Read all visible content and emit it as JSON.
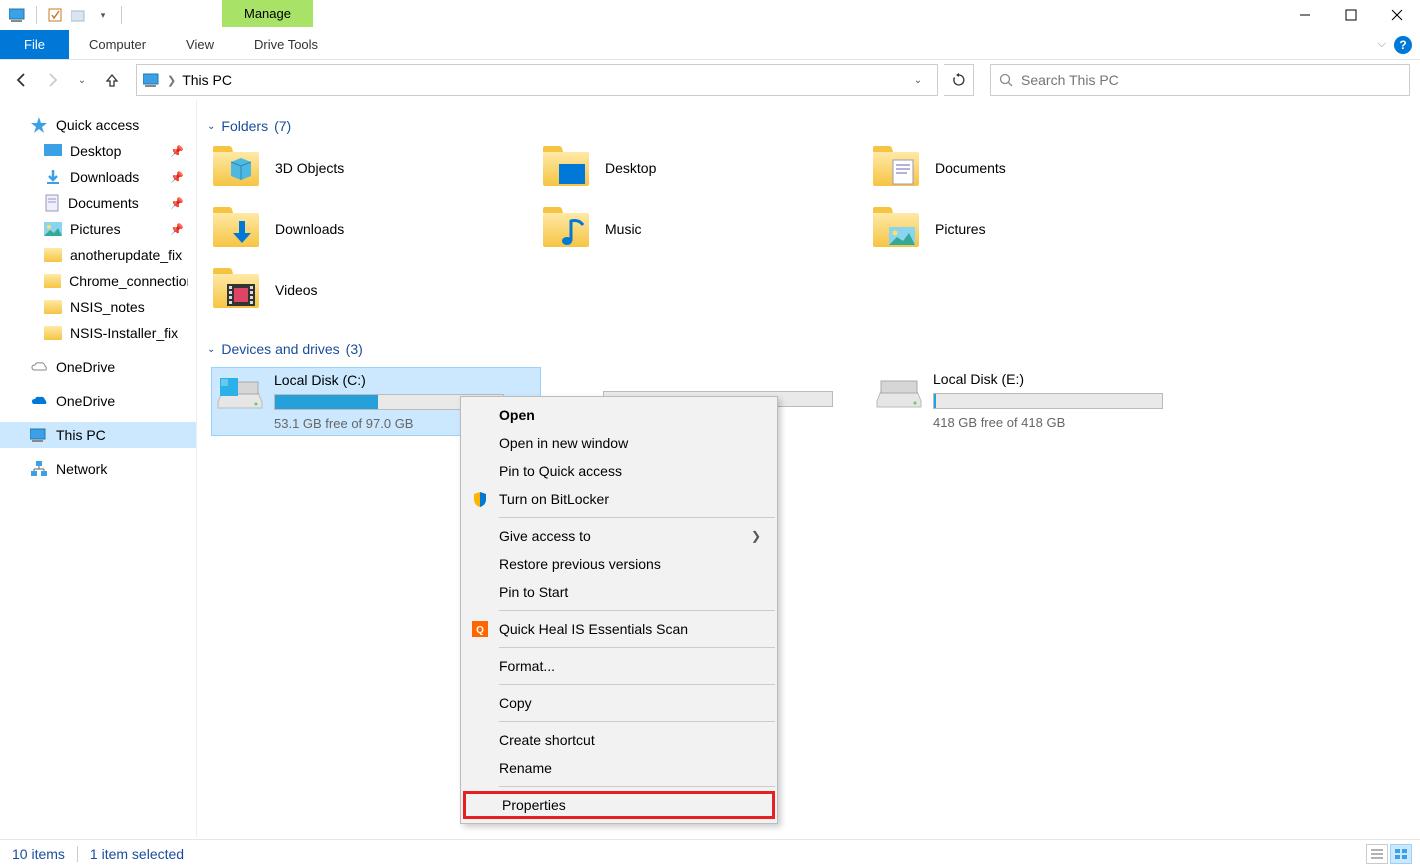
{
  "window": {
    "title": "This PC",
    "manage_label": "Manage"
  },
  "ribbon": {
    "file": "File",
    "tabs": [
      "Computer",
      "View",
      "Drive Tools"
    ]
  },
  "address": {
    "path": "This PC"
  },
  "search": {
    "placeholder": "Search This PC"
  },
  "sidebar": {
    "quick_access": "Quick access",
    "items": [
      {
        "label": "Desktop",
        "pinned": true
      },
      {
        "label": "Downloads",
        "pinned": true
      },
      {
        "label": "Documents",
        "pinned": true
      },
      {
        "label": "Pictures",
        "pinned": true
      },
      {
        "label": "anotherupdate_fix",
        "pinned": false
      },
      {
        "label": "Chrome_connection",
        "pinned": false
      },
      {
        "label": "NSIS_notes",
        "pinned": false
      },
      {
        "label": "NSIS-Installer_fix",
        "pinned": false
      }
    ],
    "onedrive1": "OneDrive",
    "onedrive2": "OneDrive",
    "this_pc": "This PC",
    "network": "Network"
  },
  "groups": {
    "folders": {
      "label": "Folders",
      "count": "(7)"
    },
    "drives": {
      "label": "Devices and drives",
      "count": "(3)"
    }
  },
  "folders": [
    "3D Objects",
    "Desktop",
    "Documents",
    "Downloads",
    "Music",
    "Pictures",
    "Videos"
  ],
  "drives": [
    {
      "name": "Local Disk (C:)",
      "free": "53.1 GB free of 97.0 GB",
      "fill_pct": 45,
      "selected": true
    },
    {
      "name": "",
      "free": "",
      "fill_pct": 0,
      "hidden_by_menu": true
    },
    {
      "name": "Local Disk (E:)",
      "free": "418 GB free of 418 GB",
      "fill_pct": 1,
      "selected": false
    }
  ],
  "context_menu": [
    {
      "label": "Open",
      "bold": true
    },
    {
      "label": "Open in new window"
    },
    {
      "label": "Pin to Quick access"
    },
    {
      "label": "Turn on BitLocker",
      "icon": "shield"
    },
    {
      "sep": true
    },
    {
      "label": "Give access to",
      "submenu": true
    },
    {
      "label": "Restore previous versions"
    },
    {
      "label": "Pin to Start"
    },
    {
      "sep": true
    },
    {
      "label": "Quick Heal IS Essentials Scan",
      "icon": "quickheal"
    },
    {
      "sep": true
    },
    {
      "label": "Format..."
    },
    {
      "sep": true
    },
    {
      "label": "Copy"
    },
    {
      "sep": true
    },
    {
      "label": "Create shortcut"
    },
    {
      "label": "Rename"
    },
    {
      "sep": true
    },
    {
      "label": "Properties",
      "highlight": true
    }
  ],
  "status": {
    "items": "10 items",
    "selected": "1 item selected"
  }
}
